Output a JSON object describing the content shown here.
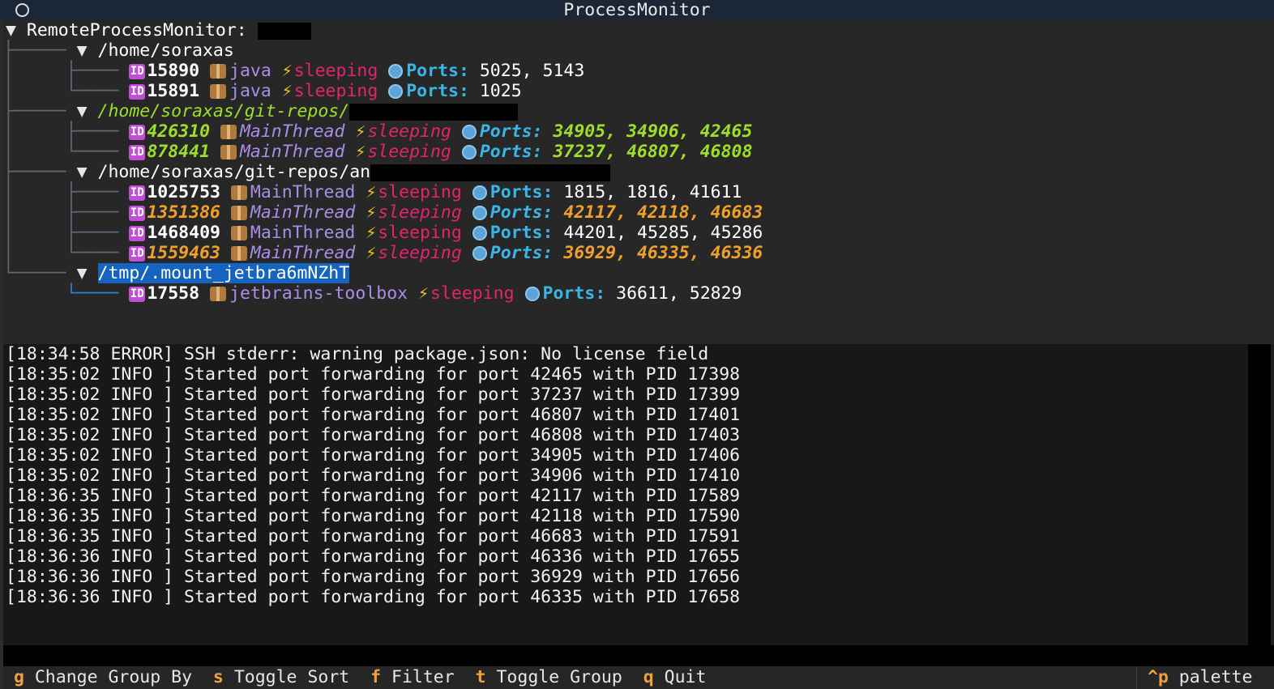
{
  "window": {
    "title": "ProcessMonitor"
  },
  "tree": {
    "root_label": "RemoteProcessMonitor:",
    "groups": [
      {
        "path": "/home/soraxas",
        "processes": [
          {
            "pid": "15890",
            "name": "java",
            "state": "sleeping",
            "ports_label": "Ports:",
            "ports": "5025, 5143"
          },
          {
            "pid": "15891",
            "name": "java",
            "state": "sleeping",
            "ports_label": "Ports:",
            "ports": "1025"
          }
        ]
      },
      {
        "path": "/home/soraxas/git-repos/",
        "processes": [
          {
            "pid": "426310",
            "name": "MainThread",
            "state": "sleeping",
            "ports_label": "Ports:",
            "ports": "34905, 34906, 42465"
          },
          {
            "pid": "878441",
            "name": "MainThread",
            "state": "sleeping",
            "ports_label": "Ports:",
            "ports": "37237, 46807, 46808"
          }
        ]
      },
      {
        "path": "/home/soraxas/git-repos/an",
        "processes": [
          {
            "pid": "1025753",
            "name": "MainThread",
            "state": "sleeping",
            "ports_label": "Ports:",
            "ports": "1815, 1816, 41611"
          },
          {
            "pid": "1351386",
            "name": "MainThread",
            "state": "sleeping",
            "ports_label": "Ports:",
            "ports": "42117, 42118, 46683"
          },
          {
            "pid": "1468409",
            "name": "MainThread",
            "state": "sleeping",
            "ports_label": "Ports:",
            "ports": "44201, 45285, 45286"
          },
          {
            "pid": "1559463",
            "name": "MainThread",
            "state": "sleeping",
            "ports_label": "Ports:",
            "ports": "36929, 46335, 46336"
          }
        ]
      },
      {
        "path": "/tmp/.mount_jetbra6mNZhT",
        "processes": [
          {
            "pid": "17558",
            "name": "jetbrains-toolbox",
            "state": "sleeping",
            "ports_label": "Ports:",
            "ports": "36611, 52829"
          }
        ]
      }
    ]
  },
  "log": [
    "[18:34:58 ERROR] SSH stderr: warning package.json: No license field",
    "[18:35:02 INFO ] Started port forwarding for port 42465 with PID 17398",
    "[18:35:02 INFO ] Started port forwarding for port 37237 with PID 17399",
    "[18:35:02 INFO ] Started port forwarding for port 46807 with PID 17401",
    "[18:35:02 INFO ] Started port forwarding for port 46808 with PID 17403",
    "[18:35:02 INFO ] Started port forwarding for port 34905 with PID 17406",
    "[18:35:02 INFO ] Started port forwarding for port 34906 with PID 17410",
    "[18:36:35 INFO ] Started port forwarding for port 42117 with PID 17589",
    "[18:36:35 INFO ] Started port forwarding for port 42118 with PID 17590",
    "[18:36:35 INFO ] Started port forwarding for port 46683 with PID 17591",
    "[18:36:36 INFO ] Started port forwarding for port 46336 with PID 17655",
    "[18:36:36 INFO ] Started port forwarding for port 36929 with PID 17656",
    "[18:36:36 INFO ] Started port forwarding for port 46335 with PID 17658"
  ],
  "footer": {
    "bindings": [
      {
        "key": "g",
        "label": "Change Group By"
      },
      {
        "key": "s",
        "label": "Toggle Sort"
      },
      {
        "key": "f",
        "label": "Filter"
      },
      {
        "key": "t",
        "label": "Toggle Group"
      },
      {
        "key": "q",
        "label": "Quit"
      }
    ],
    "palette": {
      "key": "^p",
      "label": "palette"
    }
  },
  "icons": {
    "id_badge": "ID",
    "bolt": "⚡",
    "tree_arrow": "▼"
  },
  "colors": {
    "header_bg": "#1b2636",
    "pid_badge": "#c14fd6",
    "state": "#e2246e",
    "ports_label": "#39b6e6",
    "highlight_green": "#9ede2b",
    "highlight_orange": "#f0a02a",
    "selection": "#1565c0",
    "footer_key": "#f2a03b"
  }
}
